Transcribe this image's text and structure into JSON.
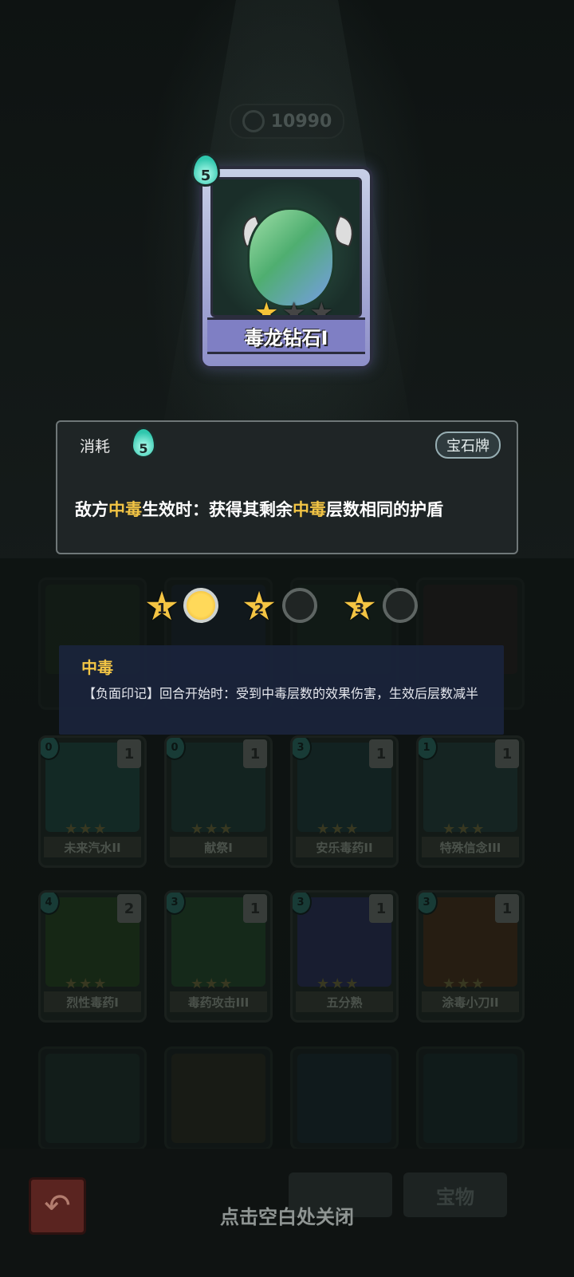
{
  "currency": {
    "value": "10990",
    "icon": "currency-icon"
  },
  "hero_card": {
    "cost": "5",
    "name": "毒龙钻石I",
    "stars": {
      "filled": 1,
      "total": 3
    }
  },
  "description": {
    "cost_label": "消耗",
    "cost": "5",
    "type_badge": "宝石牌",
    "text_parts": [
      "敌方",
      "中毒",
      "生效时：获得其剩余",
      "中毒",
      "层数相同的护盾"
    ]
  },
  "upgrade_levels": [
    {
      "level": "1",
      "active": true
    },
    {
      "level": "2",
      "active": false
    },
    {
      "level": "3",
      "active": false
    }
  ],
  "tooltip": {
    "title": "中毒",
    "body": "【负面印记】回合开始时：受到中毒层数的效果伤害，生效后层数减半"
  },
  "cards": [
    {
      "name": "未来汽水II",
      "cost": "0",
      "count": "1",
      "color": "#1f4a44"
    },
    {
      "name": "献祭I",
      "cost": "0",
      "count": "1",
      "color": "#203c38"
    },
    {
      "name": "安乐毒药II",
      "cost": "3",
      "count": "1",
      "color": "#1e3a3a"
    },
    {
      "name": "特殊信念III",
      "cost": "1",
      "count": "1",
      "color": "#243f3c"
    },
    {
      "name": "烈性毒药I",
      "cost": "4",
      "count": "2",
      "color": "#27451f"
    },
    {
      "name": "毒药攻击III",
      "cost": "3",
      "count": "1",
      "color": "#244a2a"
    },
    {
      "name": "五分熟",
      "cost": "3",
      "count": "1",
      "color": "#2c2f5c"
    },
    {
      "name": "涂毒小刀II",
      "cost": "3",
      "count": "1",
      "color": "#4a3019"
    }
  ],
  "bottom": {
    "close_hint": "点击空白处关闭",
    "tab_treasure": "宝物"
  }
}
